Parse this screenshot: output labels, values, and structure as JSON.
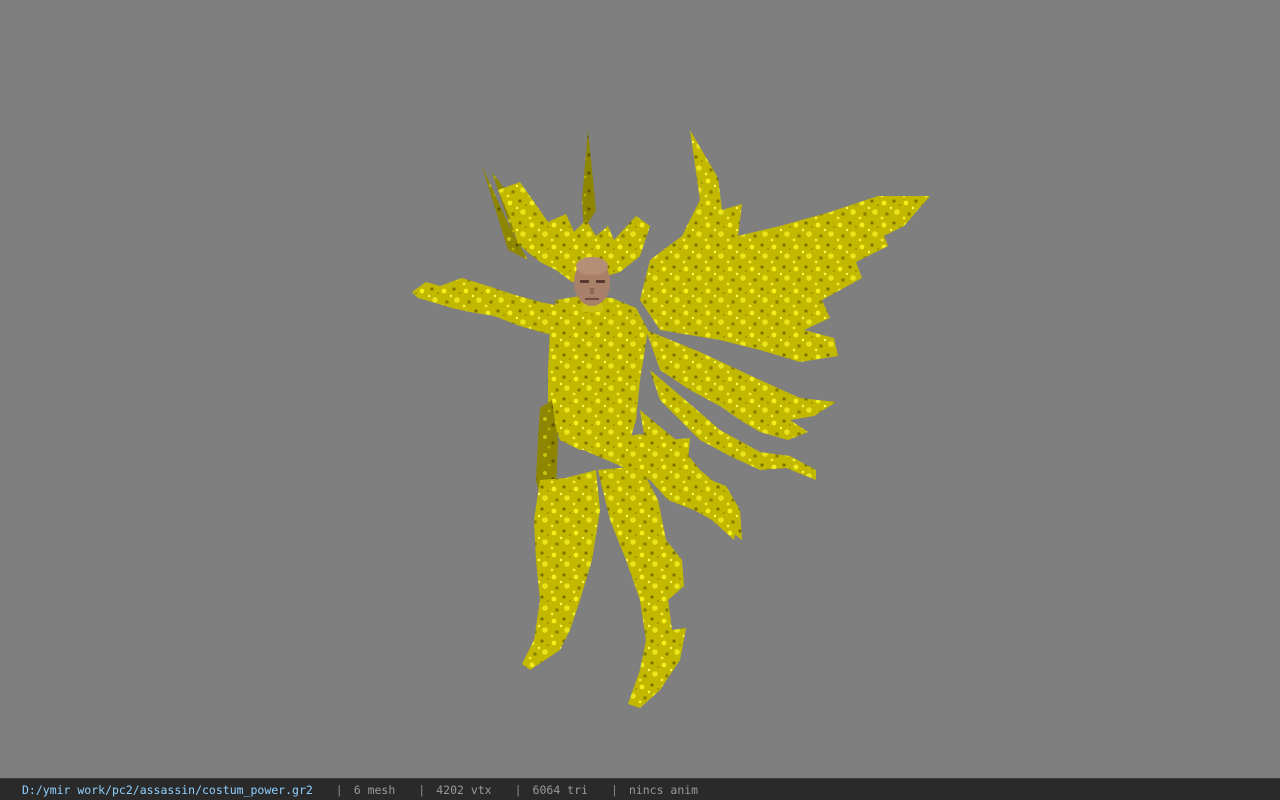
{
  "viewport": {
    "background_color": "#7f7f7f",
    "model": {
      "primary_color": "#c8c000",
      "shadow_color": "#6a6a00",
      "highlight_color": "#f2ee1a",
      "skin_color": "#a9806a"
    }
  },
  "statusbar": {
    "file_path": "D:/ymir work/pc2/assassin/costum_power.gr2",
    "separator": "|",
    "mesh_count": "6 mesh",
    "vertex_count": "4202 vtx",
    "triangle_count": "6064 tri",
    "animation": "nincs anim",
    "path_color": "#8fd0ff",
    "text_color": "#9a9a9a"
  }
}
